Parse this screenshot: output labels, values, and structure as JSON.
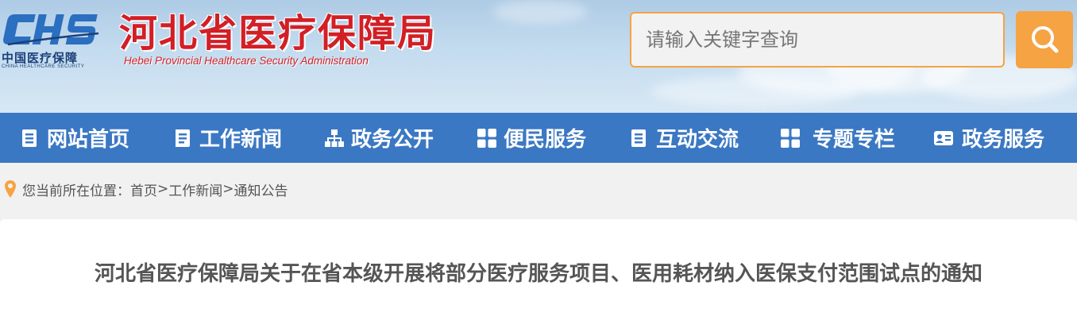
{
  "header": {
    "logo": {
      "abbr": "CHS",
      "cn": "中国医疗保障",
      "en": "CHINA HEALTHCARE SECURITY"
    },
    "brand_cn": "河北省医疗保障局",
    "brand_en": "Hebei Provincial Healthcare Security Administration",
    "search": {
      "placeholder": "请输入关键字查询",
      "value": "",
      "button_icon": "search-icon"
    }
  },
  "nav": {
    "items": [
      {
        "label": "网站首页",
        "icon": "document-icon"
      },
      {
        "label": "工作新闻",
        "icon": "bookmark-icon"
      },
      {
        "label": "政务公开",
        "icon": "sitemap-icon"
      },
      {
        "label": "便民服务",
        "icon": "grid-icon"
      },
      {
        "label": "互动交流",
        "icon": "document-icon"
      },
      {
        "label": "专题专栏",
        "icon": "grid-icon"
      },
      {
        "label": "政务服务",
        "icon": "id-card-icon"
      }
    ]
  },
  "breadcrumb": {
    "prefix": "您当前所在位置：",
    "items": [
      "首页",
      "工作新闻",
      "通知公告"
    ],
    "separator": ">"
  },
  "article": {
    "title": "河北省医疗保障局关于在省本级开展将部分医疗服务项目、医用耗材纳入医保支付范围试点的通知"
  },
  "colors": {
    "nav_bg": "#3b78c3",
    "accent": "#f5a343",
    "brand_red": "#d21f26",
    "logo_blue": "#2a6fc0"
  }
}
